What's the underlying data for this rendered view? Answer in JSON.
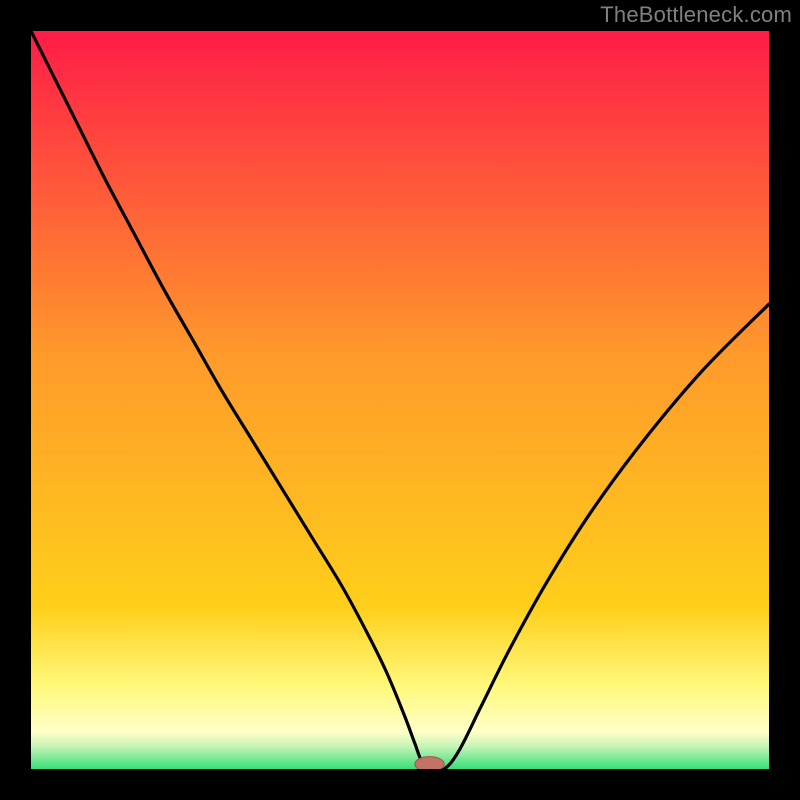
{
  "watermark": "TheBottleneck.com",
  "colors": {
    "frame": "#000000",
    "watermark": "#808080",
    "gradient_top": "#ff1c47",
    "gradient_mid": "#ffcf1a",
    "gradient_yellow_band_top": "#fff97d",
    "gradient_yellow_band_bottom": "#ffffc8",
    "gradient_green": "#35e078",
    "curve": "#000000",
    "marker_fill": "#c47166",
    "marker_stroke": "#9b5850"
  },
  "chart_data": {
    "type": "line",
    "title": "",
    "xlabel": "",
    "ylabel": "",
    "xlim": [
      0,
      100
    ],
    "ylim": [
      0,
      100
    ],
    "grid": false,
    "series": [
      {
        "name": "bottleneck-curve",
        "x": [
          0,
          3,
          6,
          10,
          14,
          18,
          22,
          26,
          30,
          34,
          38,
          42,
          45,
          48,
          50.5,
          52,
          53,
          54.5,
          56,
          58,
          61,
          65,
          70,
          76,
          83,
          91,
          100
        ],
        "y": [
          100,
          94,
          88,
          80,
          72.5,
          65,
          58,
          51,
          44.5,
          38,
          31.5,
          25,
          19.5,
          13.5,
          7.5,
          3.5,
          1.0,
          0.0,
          0.0,
          2.5,
          8.5,
          16.5,
          25.5,
          35,
          44.5,
          54,
          63
        ]
      }
    ],
    "marker": {
      "x": 54,
      "y": 0,
      "rx": 2.0,
      "ry": 1.0
    },
    "annotations": []
  }
}
